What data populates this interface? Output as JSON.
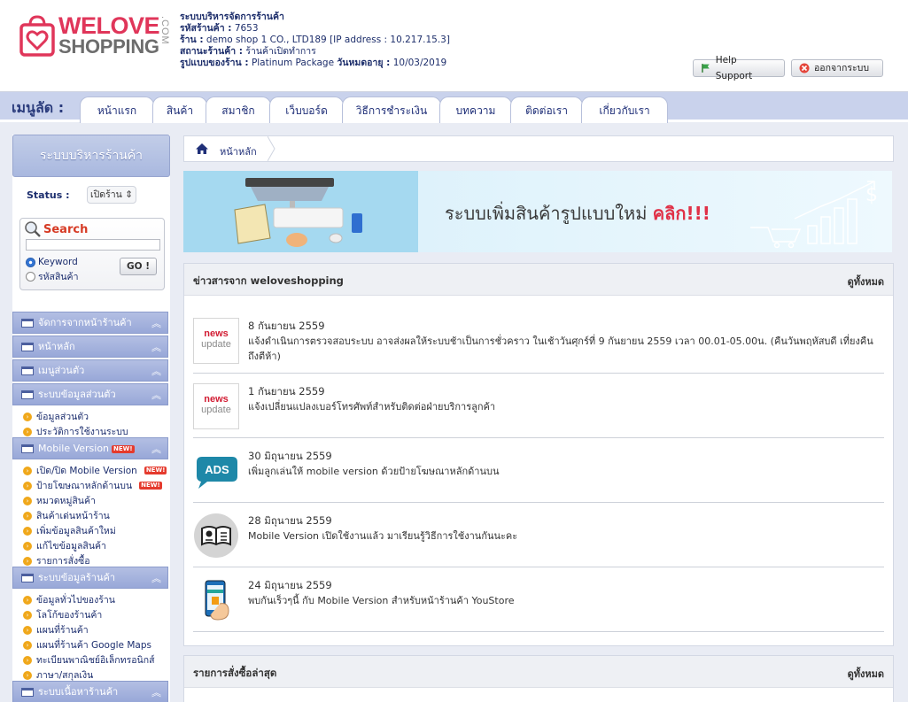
{
  "header": {
    "logo": {
      "line1": "WELOVE",
      "line2": "SHOPPING",
      "suffix": ".COM"
    },
    "system_name": "ระบบบริหารจัดการร้านค้า",
    "shop_code_label": "รหัสร้านค้า :",
    "shop_code": "7653",
    "shop_label": "ร้าน :",
    "shop_name": "demo shop 1 CO., LTD189 [IP address : 10.217.15.3]",
    "shop_status_label": "สถานะร้านค้า :",
    "shop_status": "ร้านค้าเปิดทำการ",
    "package_label": "รูปแบบของร้าน :",
    "package": "Platinum Package",
    "expiry_label": "วันหมดอายุ :",
    "expiry": "10/03/2019",
    "help_label": "Help Support",
    "logout_label": "ออกจากระบบ"
  },
  "menu": {
    "title": "เมนูลัด :",
    "tabs": [
      "หน้าแรก",
      "สินค้า",
      "สมาชิก",
      "เว็บบอร์ด",
      "วิธีการชำระเงิน",
      "บทความ",
      "ติดต่อเรา",
      "เกี่ยวกับเรา"
    ]
  },
  "sidebar": {
    "title": "ระบบบริหารร้านค้า",
    "status_label": "Status :",
    "status_value": "เปิดร้าน",
    "search_title": "Search",
    "search_value": "",
    "radio_keyword": "Keyword",
    "radio_code": "รหัสสินค้า",
    "go_label": "GO !",
    "sections": [
      "จัดการจากหน้าร้านค้า",
      "หน้าหลัก",
      "เมนูส่วนตัว",
      "ระบบข้อมูลส่วนตัว",
      "Mobile Version",
      "ระบบข้อมูลร้านค้า",
      "ระบบเนื้อหาร้านค้า"
    ],
    "new_badge": "NEW!",
    "personal_items": [
      "ข้อมูลส่วนตัว",
      "ประวัติการใช้งานระบบ"
    ],
    "mobile_items": [
      "เปิด/ปิด Mobile Version",
      "ป้ายโฆษณาหลักด้านบน",
      "หมวดหมู่สินค้า",
      "สินค้าเด่นหน้าร้าน",
      "เพิ่มข้อมูลสินค้าใหม่",
      "แก้ไขข้อมูลสินค้า",
      "รายการสั่งซื้อ"
    ],
    "shop_items": [
      "ข้อมูลทั่วไปของร้าน",
      "โลโก้ของร้านค้า",
      "แผนที่ร้านค้า",
      "แผนที่ร้านค้า Google Maps",
      "ทะเบียนพาณิชย์อิเล็กทรอนิกส์",
      "ภาษา/สกุลเงิน"
    ]
  },
  "breadcrumb": {
    "home": "หน้าหลัก"
  },
  "banner": {
    "text": "ระบบเพิ่มสินค้ารูปแบบใหม่",
    "click": "คลิก!!!"
  },
  "news_panel": {
    "title": "ข่าวสารจาก weloveshopping",
    "more": "ดูทั้งหมด",
    "items": [
      {
        "icon": "news-update",
        "date": "8 กันยายน 2559",
        "text": "แจ้งดำเนินการตรวจสอบระบบ อาจส่งผลให้ระบบช้าเป็นการชั่วคราว ในเช้าวันศุกร์ที่ 9 กันยายน 2559 เวลา 00.01-05.00น. (คืนวันพฤหัสบดี เที่ยงคืนถึงตีห้า)"
      },
      {
        "icon": "news-update",
        "date": "1 กันยายน 2559",
        "text": "แจ้งเปลี่ยนแปลงเบอร์โทรศัพท์สำหรับติดต่อฝ่ายบริการลูกค้า"
      },
      {
        "icon": "ads",
        "date": "30 มิถุนายน 2559",
        "text": "เพิ่มลูกเล่นให้ mobile version ด้วยป้ายโฆษณาหลักด้านบน",
        "icon_text": "ADS"
      },
      {
        "icon": "manual",
        "date": "28 มิถุนายน 2559",
        "text": "Mobile Version เปิดใช้งานแล้ว มาเรียนรู้วิธีการใช้งานกันนะคะ"
      },
      {
        "icon": "mobile-shop",
        "date": "24 มิถุนายน 2559",
        "text": "พบกันเร็วๆนี้ กับ Mobile Version สำหรับหน้าร้านค้า YouStore"
      }
    ],
    "news_word": "news",
    "update_word": "update"
  },
  "orders_panel": {
    "title": "รายการสั่งซื้อล่าสุด",
    "more": "ดูทั้งหมด"
  },
  "colors": {
    "brand_pink": "#e0365a",
    "nav_blue": "#1f2f78",
    "sidebar_blue": "#a9b8df"
  }
}
